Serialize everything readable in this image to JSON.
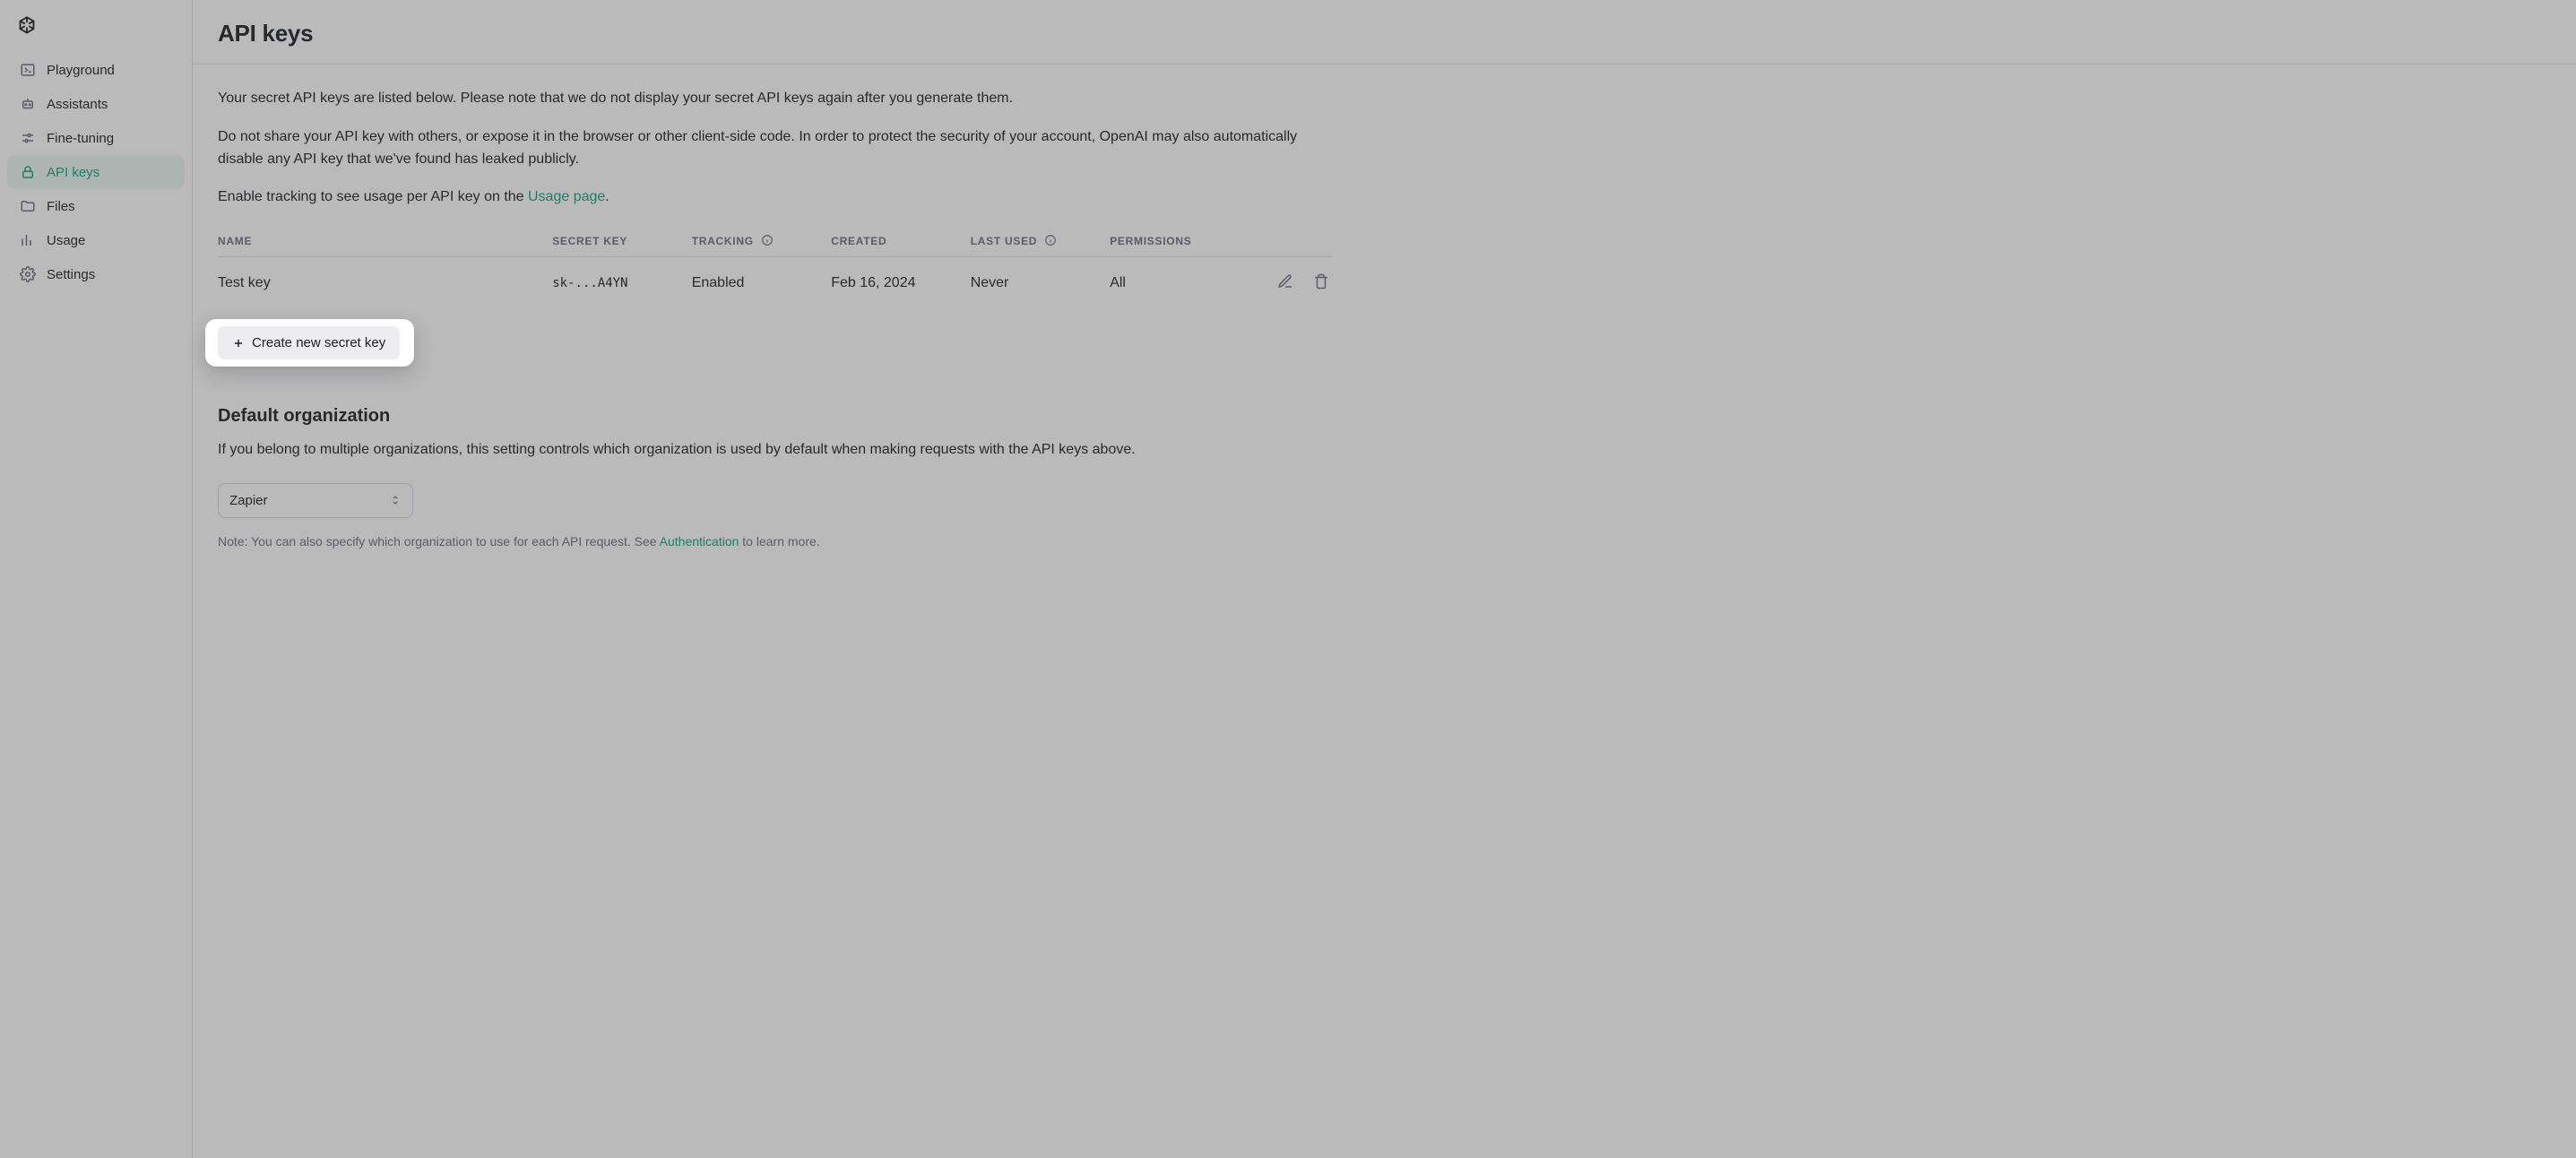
{
  "sidebar": {
    "items": [
      {
        "label": "Playground",
        "icon": "terminal"
      },
      {
        "label": "Assistants",
        "icon": "robot"
      },
      {
        "label": "Fine-tuning",
        "icon": "sliders"
      },
      {
        "label": "API keys",
        "icon": "lock",
        "active": true
      },
      {
        "label": "Files",
        "icon": "folder"
      },
      {
        "label": "Usage",
        "icon": "chart"
      },
      {
        "label": "Settings",
        "icon": "gear"
      }
    ]
  },
  "header": {
    "title": "API keys"
  },
  "intro": {
    "p1": "Your secret API keys are listed below. Please note that we do not display your secret API keys again after you generate them.",
    "p2": "Do not share your API key with others, or expose it in the browser or other client-side code. In order to protect the security of your account, OpenAI may also automatically disable any API key that we've found has leaked publicly.",
    "p3_pre": "Enable tracking to see usage per API key on the ",
    "p3_link": "Usage page",
    "p3_post": "."
  },
  "keys_table": {
    "columns": [
      "Name",
      "Secret key",
      "Tracking",
      "Created",
      "Last used",
      "Permissions"
    ],
    "rows": [
      {
        "name": "Test key",
        "secret": "sk-...A4YN",
        "tracking": "Enabled",
        "created": "Feb 16, 2024",
        "last_used": "Never",
        "permissions": "All"
      }
    ]
  },
  "create_button": "Create new secret key",
  "default_org": {
    "heading": "Default organization",
    "desc": "If you belong to multiple organizations, this setting controls which organization is used by default when making requests with the API keys above.",
    "selected": "Zapier",
    "note_pre": "Note: You can also specify which organization to use for each API request. See ",
    "note_link": "Authentication",
    "note_post": " to learn more."
  }
}
